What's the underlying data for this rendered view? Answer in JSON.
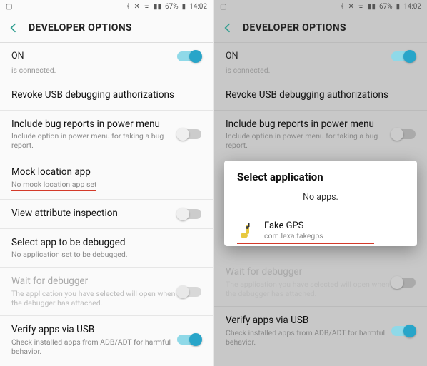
{
  "status": {
    "battery": "67%",
    "time": "14:02"
  },
  "header": {
    "title": "DEVELOPER OPTIONS"
  },
  "left": {
    "on_label": "ON",
    "connected_text": "is connected.",
    "revoke": "Revoke USB debugging authorizations",
    "bugreport_title": "Include bug reports in power menu",
    "bugreport_sub": "Include option in power menu for taking a bug report.",
    "mock_title": "Mock location app",
    "mock_sub": "No mock location app set",
    "view_attr": "View attribute inspection",
    "select_debug_title": "Select app to be debugged",
    "select_debug_sub": "No application set to be debugged.",
    "wait_title": "Wait for debugger",
    "wait_sub": "The application you have selected will open when the debugger has attached.",
    "verify_title": "Verify apps via USB",
    "verify_sub": "Check installed apps from ADB/ADT for harmful behavior."
  },
  "dialog": {
    "title": "Select application",
    "noapps": "No apps.",
    "app_name": "Fake GPS",
    "app_pkg": "com.lexa.fakegps"
  }
}
